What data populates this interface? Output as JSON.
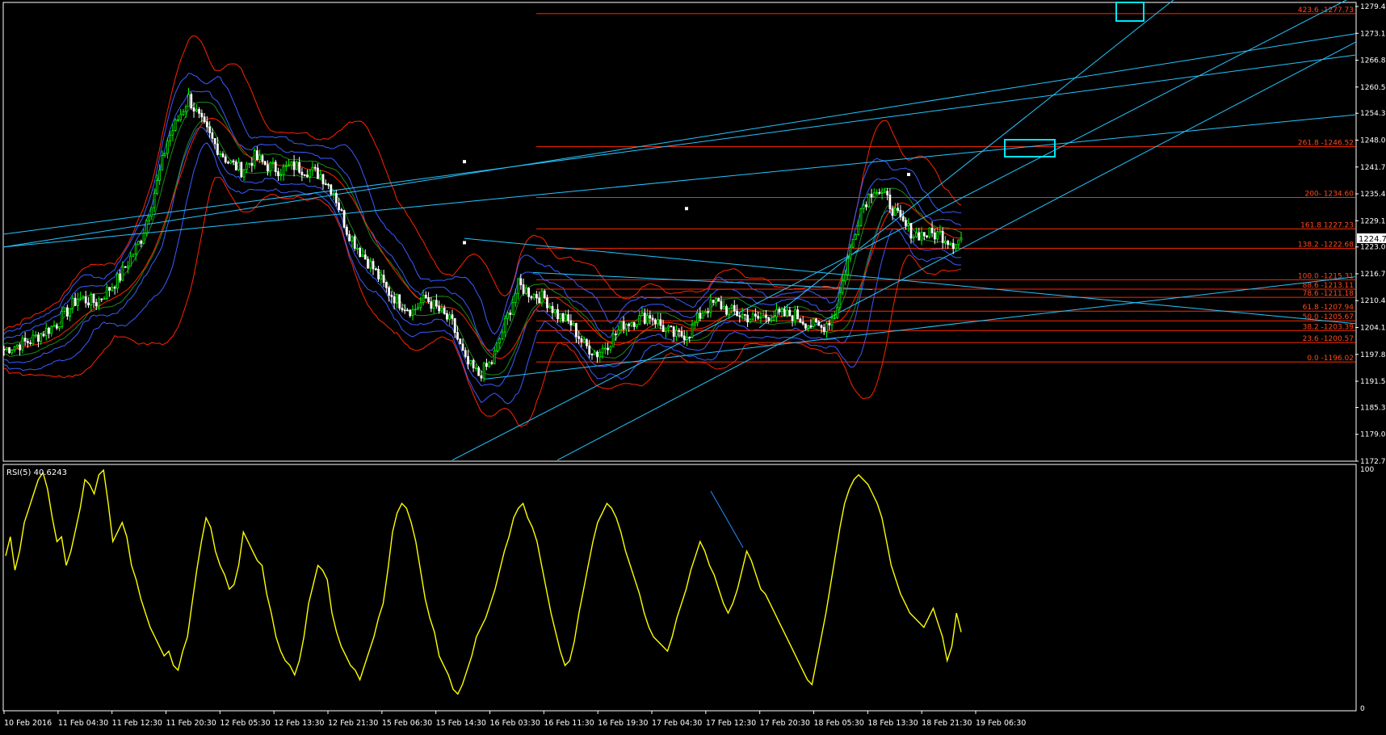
{
  "colors": {
    "background": "#000000",
    "frame": "#ffffff",
    "candle_up": "#00ff00",
    "candle_down": "#ffffff",
    "fib": "#ff2a00",
    "fib_label": "#ff4a1a",
    "trend": "#1e90ff",
    "trend_light": "#26c6ff",
    "bb_blue": "#3a5cff",
    "bb_red": "#ff2200",
    "ma_green": "#1a8a1a",
    "rsi": "#ffff00",
    "axis_text": "#ffffff",
    "cyan_box": "#00e5ff"
  },
  "rsi_label": "RSI(5) 40.6243",
  "current_price_tag": "1224.70",
  "chart_data": [
    {
      "type": "candlestick",
      "price_axis": {
        "labels": [
          "1279.40",
          "1273.10",
          "1266.80",
          "1260.50",
          "1254.35",
          "1248.05",
          "1241.75",
          "1235.45",
          "1229.15",
          "1223.00",
          "1216.70",
          "1210.40",
          "1204.10",
          "1197.80",
          "1191.50",
          "1185.35",
          "1179.05",
          "1172.75"
        ],
        "range": [
          1172.75,
          1279.4
        ]
      },
      "time_axis": {
        "labels": [
          "10 Feb 2016",
          "11 Feb 04:30",
          "11 Feb 12:30",
          "11 Feb 20:30",
          "12 Feb 05:30",
          "12 Feb 13:30",
          "12 Feb 21:30",
          "15 Feb 06:30",
          "15 Feb 14:30",
          "16 Feb 03:30",
          "16 Feb 11:30",
          "16 Feb 19:30",
          "17 Feb 04:30",
          "17 Feb 12:30",
          "17 Feb 20:30",
          "18 Feb 05:30",
          "18 Feb 13:30",
          "18 Feb 21:30",
          "19 Feb 06:30"
        ]
      },
      "price_path": [
        [
          0,
          1199
        ],
        [
          10,
          1201
        ],
        [
          20,
          1205
        ],
        [
          28,
          1211
        ],
        [
          35,
          1210
        ],
        [
          44,
          1216
        ],
        [
          52,
          1225
        ],
        [
          58,
          1238
        ],
        [
          62,
          1248
        ],
        [
          66,
          1253
        ],
        [
          70,
          1258
        ],
        [
          75,
          1252
        ],
        [
          80,
          1247
        ],
        [
          85,
          1243
        ],
        [
          90,
          1241
        ],
        [
          95,
          1244
        ],
        [
          100,
          1242
        ],
        [
          105,
          1241
        ],
        [
          110,
          1242
        ],
        [
          115,
          1241
        ],
        [
          120,
          1240
        ],
        [
          125,
          1236
        ],
        [
          130,
          1227
        ],
        [
          135,
          1222
        ],
        [
          140,
          1218
        ],
        [
          145,
          1213
        ],
        [
          150,
          1210
        ],
        [
          155,
          1208
        ],
        [
          160,
          1211
        ],
        [
          165,
          1208
        ],
        [
          170,
          1205
        ],
        [
          175,
          1196
        ],
        [
          180,
          1193
        ],
        [
          185,
          1196
        ],
        [
          190,
          1205
        ],
        [
          195,
          1214
        ],
        [
          200,
          1212
        ],
        [
          205,
          1211
        ],
        [
          210,
          1207
        ],
        [
          215,
          1205
        ],
        [
          220,
          1200
        ],
        [
          225,
          1198
        ],
        [
          230,
          1201
        ],
        [
          235,
          1205
        ],
        [
          240,
          1206
        ],
        [
          245,
          1207
        ],
        [
          250,
          1204
        ],
        [
          255,
          1202
        ],
        [
          260,
          1203
        ],
        [
          265,
          1208
        ],
        [
          270,
          1210
        ],
        [
          275,
          1208
        ],
        [
          280,
          1207
        ],
        [
          285,
          1206
        ],
        [
          290,
          1207
        ],
        [
          295,
          1207
        ],
        [
          300,
          1207
        ],
        [
          305,
          1205
        ],
        [
          310,
          1204
        ],
        [
          315,
          1207
        ],
        [
          320,
          1220
        ],
        [
          325,
          1232
        ],
        [
          330,
          1237
        ],
        [
          335,
          1234
        ],
        [
          340,
          1229
        ],
        [
          345,
          1226
        ],
        [
          350,
          1226
        ],
        [
          355,
          1226
        ],
        [
          360,
          1224
        ],
        [
          363,
          1225
        ]
      ],
      "price_path_note_units": "time-slot index (0-363) and price",
      "fibonacci_levels": [
        {
          "label": "423.6 -1277.73",
          "price": 1277.73
        },
        {
          "label": "261.8 -1246.52",
          "price": 1246.52
        },
        {
          "label": "200- 1234.60",
          "price": 1234.6
        },
        {
          "label": "161.8 1227.23",
          "price": 1227.23
        },
        {
          "label": "138.2 -1222.68",
          "price": 1222.68
        },
        {
          "label": "100.0 -1215.31",
          "price": 1215.31
        },
        {
          "label": "88.6 -1213.11",
          "price": 1213.11
        },
        {
          "label": "78.6 -1211.18",
          "price": 1211.18
        },
        {
          "label": "61.8 -1207.94",
          "price": 1207.94
        },
        {
          "label": "50.0 -1205.67",
          "price": 1205.67
        },
        {
          "label": "38.2 -1203.39",
          "price": 1203.39
        },
        {
          "label": "23.6 -1200.57",
          "price": 1200.57
        },
        {
          "label": "0.0 -1196.02",
          "price": 1196.02
        }
      ],
      "grid": false
    },
    {
      "type": "line",
      "series": [
        {
          "name": "RSI(5)",
          "values": [
            64,
            72,
            58,
            66,
            78,
            84,
            90,
            96,
            99,
            92,
            80,
            70,
            72,
            60,
            66,
            75,
            84,
            96,
            94,
            90,
            98,
            100,
            86,
            70,
            74,
            78,
            72,
            60,
            54,
            46,
            40,
            34,
            30,
            26,
            22,
            24,
            18,
            16,
            24,
            30,
            44,
            58,
            70,
            80,
            76,
            66,
            60,
            56,
            50,
            52,
            60,
            74,
            70,
            66,
            62,
            60,
            48,
            40,
            30,
            24,
            20,
            18,
            14,
            20,
            30,
            44,
            52,
            60,
            58,
            54,
            40,
            32,
            26,
            22,
            18,
            16,
            12,
            18,
            24,
            30,
            38,
            44,
            58,
            74,
            82,
            86,
            84,
            78,
            70,
            58,
            46,
            38,
            32,
            22,
            18,
            14,
            8,
            6,
            10,
            16,
            22,
            30,
            34,
            38,
            44,
            50,
            58,
            66,
            72,
            80,
            84,
            86,
            80,
            76,
            70,
            60,
            50,
            40,
            32,
            24,
            18,
            20,
            28,
            40,
            50,
            60,
            70,
            78,
            82,
            86,
            84,
            80,
            74,
            66,
            60,
            54,
            48,
            40,
            34,
            30,
            28,
            26,
            24,
            30,
            38,
            44,
            50,
            58,
            64,
            70,
            66,
            60,
            56,
            50,
            44,
            40,
            44,
            50,
            58,
            66,
            62,
            56,
            50,
            48,
            44,
            40,
            36,
            32,
            28,
            24,
            20,
            16,
            12,
            10,
            20,
            30,
            40,
            52,
            64,
            76,
            86,
            92,
            96,
            98,
            96,
            94,
            90,
            86,
            80,
            70,
            60,
            54,
            48,
            44,
            40,
            38,
            36,
            34,
            38,
            42,
            36,
            30,
            20,
            26,
            40,
            32
          ],
          "ylim": [
            0,
            100
          ]
        }
      ],
      "axis_labels": [
        "100",
        "0"
      ]
    }
  ]
}
